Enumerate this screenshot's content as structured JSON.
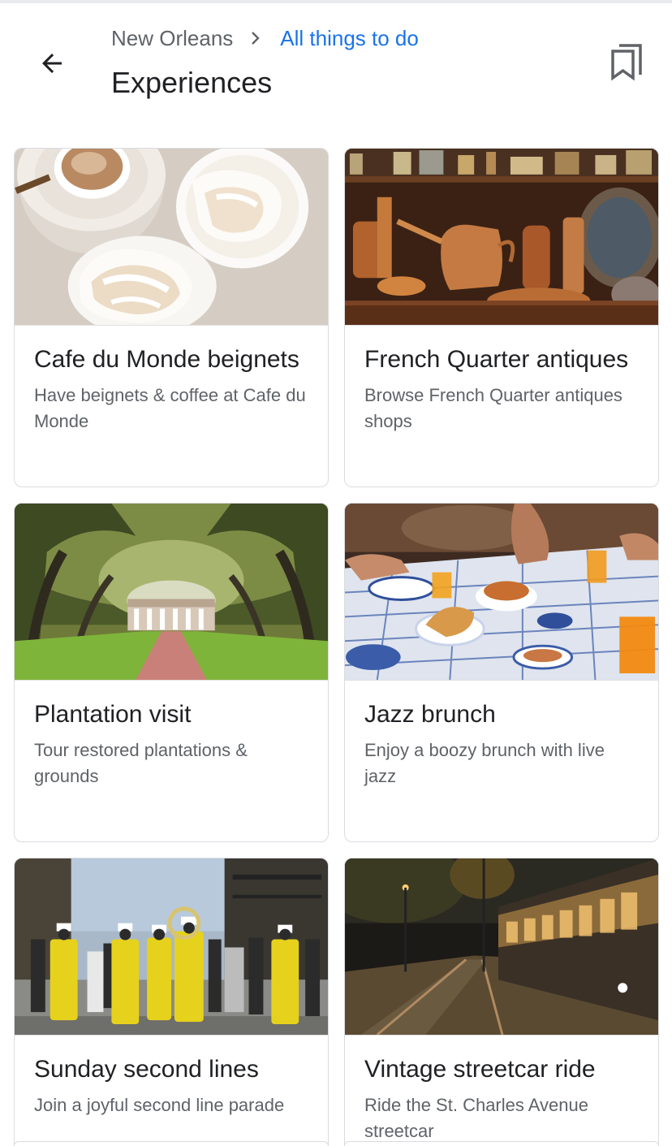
{
  "header": {
    "breadcrumb_home": "New Orleans",
    "breadcrumb_link": "All things to do",
    "title": "Experiences"
  },
  "icons": {
    "back": "arrow-back-icon",
    "separator": "chevron-right-icon",
    "save": "bookmarks-icon"
  },
  "colors": {
    "link": "#1a73e8",
    "title": "#202124",
    "secondary": "#5f6368",
    "card_border": "#dadce0"
  },
  "cards": [
    {
      "title": "Cafe du Monde beignets",
      "description": "Have beignets & coffee at Cafe du Monde",
      "image": "beignets-and-coffee-photo"
    },
    {
      "title": "French Quarter antiques",
      "description": "Browse French Quarter antiques shops",
      "image": "copper-antiques-shelf-photo"
    },
    {
      "title": "Plantation visit",
      "description": "Tour restored plantations & grounds",
      "image": "oak-alley-plantation-photo"
    },
    {
      "title": "Jazz brunch",
      "description": "Enjoy a boozy brunch with live jazz",
      "image": "brunch-table-photo"
    },
    {
      "title": "Sunday second lines",
      "description": "Join a joyful second line parade",
      "image": "second-line-brass-band-photo"
    },
    {
      "title": "Vintage streetcar ride",
      "description": "Ride the St. Charles Avenue streetcar",
      "image": "streetcar-at-dusk-photo"
    }
  ]
}
